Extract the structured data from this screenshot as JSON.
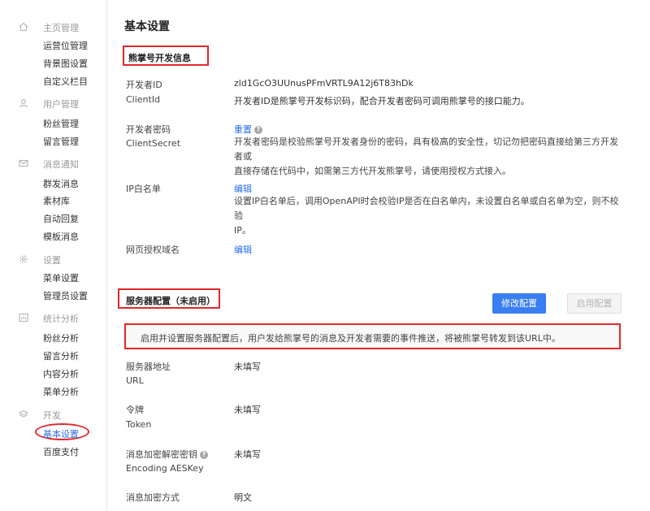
{
  "sidebar": {
    "groups": [
      {
        "title": "主页管理",
        "icon": "home-icon",
        "items": [
          "运营位管理",
          "背景图设置",
          "自定义栏目"
        ]
      },
      {
        "title": "用户管理",
        "icon": "user-icon",
        "items": [
          "粉丝管理",
          "留言管理"
        ]
      },
      {
        "title": "消息通知",
        "icon": "mail-icon",
        "items": [
          "群发消息",
          "素材库",
          "自动回复",
          "模板消息"
        ]
      },
      {
        "title": "设置",
        "icon": "gear-icon",
        "items": [
          "菜单设置",
          "管理员设置"
        ]
      },
      {
        "title": "统计分析",
        "icon": "chart-icon",
        "items": [
          "粉丝分析",
          "留言分析",
          "内容分析",
          "菜单分析"
        ]
      },
      {
        "title": "开发",
        "icon": "layers-icon",
        "items": [
          "基本设置",
          "百度支付"
        ]
      }
    ],
    "active_item": "基本设置"
  },
  "main": {
    "title": "基本设置",
    "dev_section": {
      "title": "熊掌号开发信息",
      "client_id_label": "开发者ID",
      "client_id_label_en": "ClientId",
      "client_id_value": "zld1GcO3UUnusPFmVRTL9A12j6T83hDk",
      "client_id_desc": "开发者ID是熊掌号开发标识码，配合开发者密码可调用熊掌号的接口能力。",
      "secret_label": "开发者密码",
      "secret_label_en": "ClientSecret",
      "secret_action": "重置",
      "secret_desc_line1": "开发者密码是校验熊掌号开发者身份的密码，具有极高的安全性，切记勿把密码直接给第三方开发者或",
      "secret_desc_line2": "直接存储在代码中，如需第三方代开发熊掌号，请使用授权方式接入。",
      "ip_label": "IP白名单",
      "ip_action": "编辑",
      "ip_desc_line1": "设置IP白名单后，调用OpenAPI时会校验IP是否在白名单内，未设置白名单或白名单为空，则不校验",
      "ip_desc_line2": "IP。",
      "domain_label": "网页授权域名",
      "domain_action": "编辑"
    },
    "server_section": {
      "title": "服务器配置（未启用）",
      "modify_button": "修改配置",
      "enable_button": "启用配置",
      "notice": "启用并设置服务器配置后，用户发给熊掌号的消息及开发者需要的事件推送，将被熊掌号转发到该URL中。",
      "url_label": "服务器地址",
      "url_label_en": "URL",
      "url_value": "未填写",
      "token_label": "令牌",
      "token_label_en": "Token",
      "token_value": "未填写",
      "aeskey_label": "消息加密解密密钥",
      "aeskey_label_en": "Encoding AESKey",
      "aeskey_value": "未填写",
      "encrypt_label": "消息加密方式",
      "encrypt_value": "明文"
    }
  },
  "colors": {
    "accent": "#3a7ef0",
    "highlight": "#e1272b",
    "link": "#2b6ee8"
  }
}
